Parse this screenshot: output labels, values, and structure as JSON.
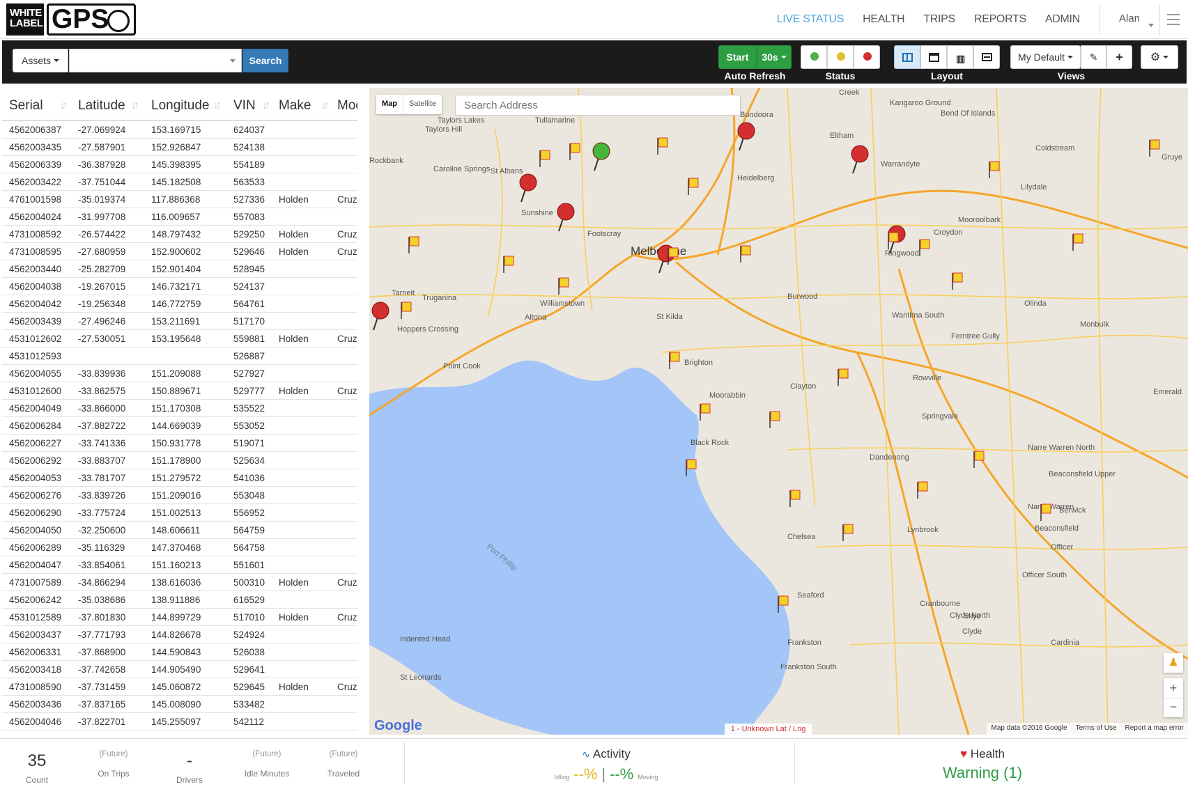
{
  "brand": {
    "logo_white": "WHITE",
    "logo_label": "LABEL",
    "logo_gps": "GPS"
  },
  "nav": {
    "items": [
      "LIVE STATUS",
      "HEALTH",
      "TRIPS",
      "REPORTS",
      "ADMIN"
    ],
    "active": "LIVE STATUS",
    "user": "Alan"
  },
  "toolbar": {
    "assets_label": "Assets",
    "search_value": "",
    "search_button": "Search",
    "start_label": "Start",
    "interval": "30s",
    "auto_refresh": "Auto Refresh",
    "status_label": "Status",
    "layout_label": "Layout",
    "views_label": "Views",
    "view_name": "My Default"
  },
  "table": {
    "columns": [
      "Serial",
      "Latitude",
      "Longitude",
      "VIN",
      "Make",
      "Mod"
    ],
    "rows": [
      [
        "4562006387",
        "-27.069924",
        "153.169715",
        "624037",
        "",
        ""
      ],
      [
        "4562003435",
        "-27.587901",
        "152.926847",
        "524138",
        "",
        ""
      ],
      [
        "4562006339",
        "-36.387928",
        "145.398395",
        "554189",
        "",
        ""
      ],
      [
        "4562003422",
        "-37.751044",
        "145.182508",
        "563533",
        "",
        ""
      ],
      [
        "4761001598",
        "-35.019374",
        "117.886368",
        "527336",
        "Holden",
        "Cruz"
      ],
      [
        "4562004024",
        "-31.997708",
        "116.009657",
        "557083",
        "",
        ""
      ],
      [
        "4731008592",
        "-26.574422",
        "148.797432",
        "529250",
        "Holden",
        "Cruz"
      ],
      [
        "4731008595",
        "-27.680959",
        "152.900602",
        "529646",
        "Holden",
        "Cruz"
      ],
      [
        "4562003440",
        "-25.282709",
        "152.901404",
        "528945",
        "",
        ""
      ],
      [
        "4562004038",
        "-19.267015",
        "146.732171",
        "524137",
        "",
        ""
      ],
      [
        "4562004042",
        "-19.256348",
        "146.772759",
        "564761",
        "",
        ""
      ],
      [
        "4562003439",
        "-27.496246",
        "153.211691",
        "517170",
        "",
        ""
      ],
      [
        "4531012602",
        "-27.530051",
        "153.195648",
        "559881",
        "Holden",
        "Cruz"
      ],
      [
        "4531012593",
        "",
        "",
        "526887",
        "",
        ""
      ],
      [
        "4562004055",
        "-33.839936",
        "151.209088",
        "527927",
        "",
        ""
      ],
      [
        "4531012600",
        "-33.862575",
        "150.889671",
        "529777",
        "Holden",
        "Cruz"
      ],
      [
        "4562004049",
        "-33.866000",
        "151.170308",
        "535522",
        "",
        ""
      ],
      [
        "4562006284",
        "-37.882722",
        "144.669039",
        "553052",
        "",
        ""
      ],
      [
        "4562006227",
        "-33.741336",
        "150.931778",
        "519071",
        "",
        ""
      ],
      [
        "4562006292",
        "-33.883707",
        "151.178900",
        "525634",
        "",
        ""
      ],
      [
        "4562004053",
        "-33.781707",
        "151.279572",
        "541036",
        "",
        ""
      ],
      [
        "4562006276",
        "-33.839726",
        "151.209016",
        "553048",
        "",
        ""
      ],
      [
        "4562006290",
        "-33.775724",
        "151.002513",
        "556952",
        "",
        ""
      ],
      [
        "4562004050",
        "-32.250600",
        "148.606611",
        "564759",
        "",
        ""
      ],
      [
        "4562006289",
        "-35.116329",
        "147.370468",
        "564758",
        "",
        ""
      ],
      [
        "4562004047",
        "-33.854061",
        "151.160213",
        "551601",
        "",
        ""
      ],
      [
        "4731007589",
        "-34.866294",
        "138.616036",
        "500310",
        "Holden",
        "Cruz"
      ],
      [
        "4562006242",
        "-35.038686",
        "138.911886",
        "616529",
        "",
        ""
      ],
      [
        "4531012589",
        "-37.801830",
        "144.899729",
        "517010",
        "Holden",
        "Cruz"
      ],
      [
        "4562003437",
        "-37.771793",
        "144.826678",
        "524924",
        "",
        ""
      ],
      [
        "4562006331",
        "-37.868900",
        "144.590843",
        "526038",
        "",
        ""
      ],
      [
        "4562003418",
        "-37.742658",
        "144.905490",
        "529641",
        "",
        ""
      ],
      [
        "4731008590",
        "-37.731459",
        "145.060872",
        "529645",
        "Holden",
        "Cruz"
      ],
      [
        "4562003436",
        "-37.837165",
        "145.008090",
        "533482",
        "",
        ""
      ],
      [
        "4562004046",
        "-37.822701",
        "145.255097",
        "542112",
        "",
        ""
      ]
    ]
  },
  "map": {
    "type_map": "Map",
    "type_satellite": "Satellite",
    "search_placeholder": "Search Address",
    "bay_label": "Port Phillip",
    "unknown_label": "1 - Unknown Lat / Lng",
    "attribution": [
      "Map data ©2016 Google",
      "Terms of Use",
      "Report a map error"
    ],
    "google": "Google",
    "zoom_in": "+",
    "zoom_out": "−",
    "places": [
      {
        "t": "Melbourne",
        "big": true
      },
      {
        "t": "Bundoora"
      },
      {
        "t": "Heidelberg"
      },
      {
        "t": "Sunshine"
      },
      {
        "t": "Footscray"
      },
      {
        "t": "St Albans"
      },
      {
        "t": "Caroline Springs"
      },
      {
        "t": "Taylors Lakes"
      },
      {
        "t": "Taylors Hill"
      },
      {
        "t": "Tullamarine"
      },
      {
        "t": "Rockbank"
      },
      {
        "t": "Tarneit"
      },
      {
        "t": "Truganina"
      },
      {
        "t": "Hoppers Crossing"
      },
      {
        "t": "Williamstown"
      },
      {
        "t": "Altona"
      },
      {
        "t": "Point Cook"
      },
      {
        "t": "St Kilda"
      },
      {
        "t": "Brighton"
      },
      {
        "t": "Moorabbin"
      },
      {
        "t": "Black Rock"
      },
      {
        "t": "Clayton"
      },
      {
        "t": "Burwood"
      },
      {
        "t": "Ringwood"
      },
      {
        "t": "Croydon"
      },
      {
        "t": "Lilydale"
      },
      {
        "t": "Warrandyte"
      },
      {
        "t": "Eltham"
      },
      {
        "t": "Kangaroo Ground"
      },
      {
        "t": "Bend Of Islands"
      },
      {
        "t": "Coldstream"
      },
      {
        "t": "Mooroolbark"
      },
      {
        "t": "Olinda"
      },
      {
        "t": "Wantirna South"
      },
      {
        "t": "Ferntree Gully"
      },
      {
        "t": "Monbulk"
      },
      {
        "t": "Rowville"
      },
      {
        "t": "Springvale"
      },
      {
        "t": "Dandenong"
      },
      {
        "t": "Narre Warren North"
      },
      {
        "t": "Narre Warren"
      },
      {
        "t": "Berwick"
      },
      {
        "t": "Beaconsfield Upper"
      },
      {
        "t": "Beaconsfield"
      },
      {
        "t": "Officer"
      },
      {
        "t": "Officer South"
      },
      {
        "t": "Lynbrook"
      },
      {
        "t": "Cranbourne"
      },
      {
        "t": "Clyde North"
      },
      {
        "t": "Clyde"
      },
      {
        "t": "Cardinia"
      },
      {
        "t": "Skye"
      },
      {
        "t": "Frankston"
      },
      {
        "t": "Frankston South"
      },
      {
        "t": "Seaford"
      },
      {
        "t": "Chelsea"
      },
      {
        "t": "Indented Head"
      },
      {
        "t": "St Leonards"
      },
      {
        "t": "Emerald"
      },
      {
        "t": "Creek"
      },
      {
        "t": "Gruye"
      }
    ]
  },
  "footer": {
    "count_value": "35",
    "count_label": "Count",
    "on_trips_future": "(Future)",
    "on_trips_label": "On Trips",
    "drivers_value": "-",
    "drivers_label": "Drivers",
    "idle_future": "(Future)",
    "idle_label": "Idle Minutes",
    "traveled_future": "(Future)",
    "traveled_label": "Traveled",
    "activity_title": "Activity",
    "idling_label": "Idling",
    "idling_value": "--%",
    "moving_value": "--%",
    "moving_label": "Moving",
    "health_title": "Health",
    "health_status": "Warning (1)"
  },
  "colors": {
    "accent": "#4fa8dd",
    "start_green": "#2e9e43",
    "search_blue": "#337ab7",
    "warning_green": "#2e9e43",
    "idling_yellow": "#e8b923"
  }
}
